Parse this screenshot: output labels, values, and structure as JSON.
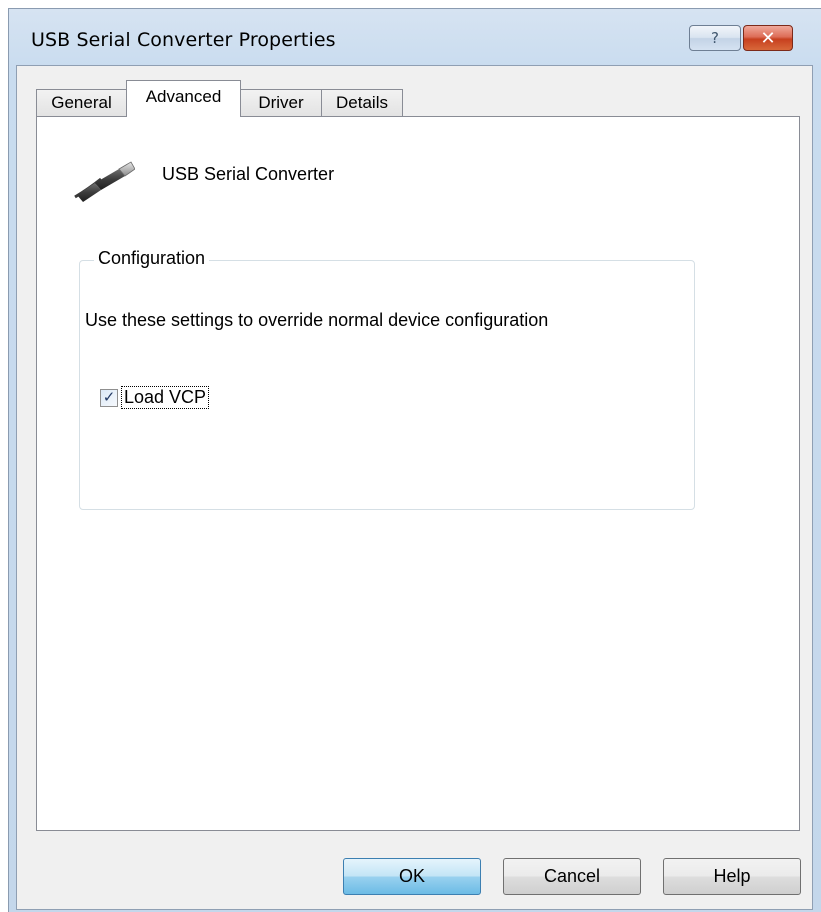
{
  "window": {
    "title": "USB Serial Converter Properties",
    "help_glyph": "?",
    "close_glyph": "✕"
  },
  "tabs": [
    {
      "label": "General",
      "active": false
    },
    {
      "label": "Advanced",
      "active": true
    },
    {
      "label": "Driver",
      "active": false
    },
    {
      "label": "Details",
      "active": false
    }
  ],
  "device": {
    "icon": "usb-plug-icon",
    "name": "USB Serial Converter"
  },
  "configuration": {
    "legend": "Configuration",
    "description": "Use these settings to override normal device configuration",
    "load_vcp": {
      "label": "Load VCP",
      "checked": true,
      "check_glyph": "✓"
    }
  },
  "buttons": {
    "ok": "OK",
    "cancel": "Cancel",
    "help": "Help"
  },
  "colors": {
    "titlebar": "#c9dcef",
    "close_button": "#c7401f",
    "default_button": "#98d1ef"
  }
}
